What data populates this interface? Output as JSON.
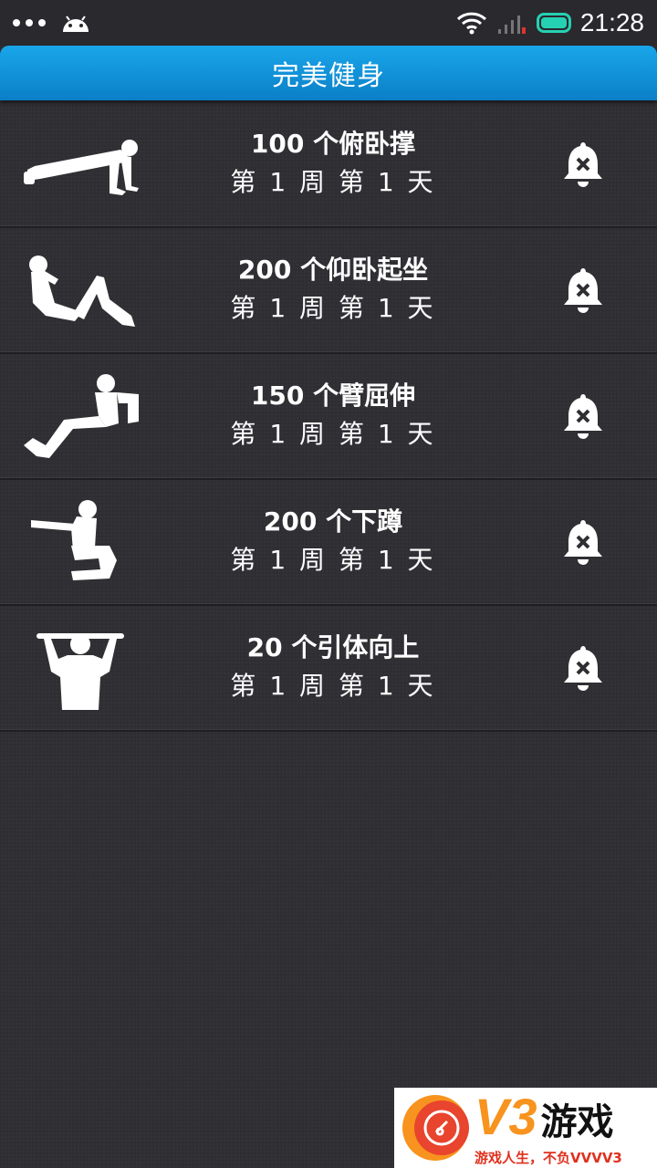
{
  "status_bar": {
    "time": "21:28",
    "icons": [
      "more-dots-icon",
      "android-icon",
      "wifi-icon",
      "signal-icon",
      "battery-icon"
    ]
  },
  "header": {
    "title": "完美健身"
  },
  "workouts": [
    {
      "title": "100 个俯卧撑",
      "progress": "第 1 周 第 1 天",
      "icon": "pushup-icon"
    },
    {
      "title": "200 个仰卧起坐",
      "progress": "第 1 周 第 1 天",
      "icon": "situp-icon"
    },
    {
      "title": "150 个臂屈伸",
      "progress": "第 1 周 第 1 天",
      "icon": "dip-icon"
    },
    {
      "title": "200 个下蹲",
      "progress": "第 1 周 第 1 天",
      "icon": "squat-icon"
    },
    {
      "title": "20 个引体向上",
      "progress": "第 1 周 第 1 天",
      "icon": "pullup-icon"
    }
  ],
  "watermark": {
    "brand": "V3",
    "name": "游戏",
    "slogan": "游戏人生，不负VVVV3"
  },
  "colors": {
    "header": "#1aa6ea",
    "background": "#2f2e33",
    "battery": "#25d1b3",
    "watermark_accent": "#f7931e"
  }
}
